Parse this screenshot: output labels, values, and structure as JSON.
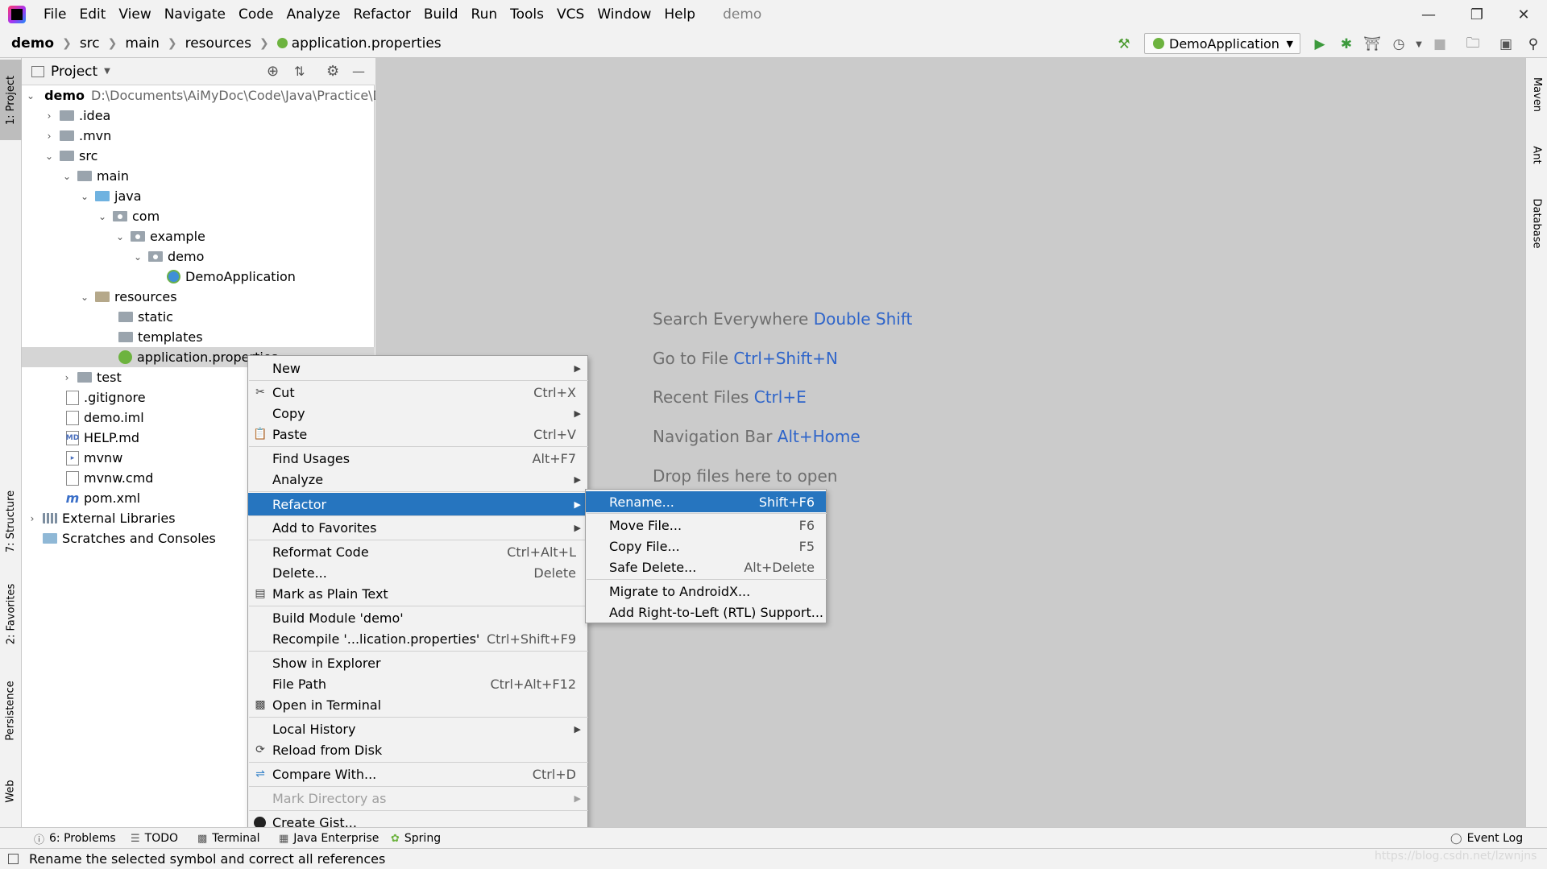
{
  "menubar": {
    "items": [
      "File",
      "Edit",
      "View",
      "Navigate",
      "Code",
      "Analyze",
      "Refactor",
      "Build",
      "Run",
      "Tools",
      "VCS",
      "Window",
      "Help"
    ],
    "window_title": "demo"
  },
  "breadcrumbs": [
    "demo",
    "src",
    "main",
    "resources",
    "application.properties"
  ],
  "run_config": "DemoApplication",
  "project_panel": {
    "title": "Project",
    "root_name": "demo",
    "root_path": "D:\\Documents\\AiMyDoc\\Code\\Java\\Practice\\D",
    "tree": [
      ".idea",
      ".mvn",
      "src",
      "main",
      "java",
      "com",
      "example",
      "demo",
      "DemoApplication",
      "resources",
      "static",
      "templates",
      "application.properties",
      "test",
      ".gitignore",
      "demo.iml",
      "HELP.md",
      "mvnw",
      "mvnw.cmd",
      "pom.xml",
      "External Libraries",
      "Scratches and Consoles"
    ]
  },
  "editor_hints": [
    {
      "label": "Search Everywhere",
      "key": "Double Shift"
    },
    {
      "label": "Go to File",
      "key": "Ctrl+Shift+N"
    },
    {
      "label": "Recent Files",
      "key": "Ctrl+E"
    },
    {
      "label": "Navigation Bar",
      "key": "Alt+Home"
    },
    {
      "label": "Drop files here to open",
      "key": ""
    }
  ],
  "context_menu": [
    {
      "label": "New",
      "shortcut": ""
    },
    {
      "label": "Cut",
      "shortcut": "Ctrl+X"
    },
    {
      "label": "Copy",
      "shortcut": ""
    },
    {
      "label": "Paste",
      "shortcut": "Ctrl+V"
    },
    {
      "label": "Find Usages",
      "shortcut": "Alt+F7"
    },
    {
      "label": "Analyze",
      "shortcut": ""
    },
    {
      "label": "Refactor",
      "shortcut": ""
    },
    {
      "label": "Add to Favorites",
      "shortcut": ""
    },
    {
      "label": "Reformat Code",
      "shortcut": "Ctrl+Alt+L"
    },
    {
      "label": "Delete...",
      "shortcut": "Delete"
    },
    {
      "label": "Mark as Plain Text",
      "shortcut": ""
    },
    {
      "label": "Build Module 'demo'",
      "shortcut": ""
    },
    {
      "label": "Recompile '...lication.properties'",
      "shortcut": "Ctrl+Shift+F9"
    },
    {
      "label": "Show in Explorer",
      "shortcut": ""
    },
    {
      "label": "File Path",
      "shortcut": "Ctrl+Alt+F12"
    },
    {
      "label": "Open in Terminal",
      "shortcut": ""
    },
    {
      "label": "Local History",
      "shortcut": ""
    },
    {
      "label": "Reload from Disk",
      "shortcut": ""
    },
    {
      "label": "Compare With...",
      "shortcut": "Ctrl+D"
    },
    {
      "label": "Mark Directory as",
      "shortcut": ""
    },
    {
      "label": "Create Gist...",
      "shortcut": ""
    }
  ],
  "refactor_submenu": [
    {
      "label": "Rename...",
      "shortcut": "Shift+F6"
    },
    {
      "label": "Move File...",
      "shortcut": "F6"
    },
    {
      "label": "Copy File...",
      "shortcut": "F5"
    },
    {
      "label": "Safe Delete...",
      "shortcut": "Alt+Delete"
    },
    {
      "label": "Migrate to AndroidX...",
      "shortcut": ""
    },
    {
      "label": "Add Right-to-Left (RTL) Support...",
      "shortcut": ""
    }
  ],
  "left_tabs": [
    "1: Project",
    "7: Structure",
    "2: Favorites",
    "Persistence",
    "Web"
  ],
  "right_tabs": [
    "Maven",
    "Ant",
    "Database"
  ],
  "bottom_tabs": [
    "6: Problems",
    "TODO",
    "Terminal",
    "Java Enterprise",
    "Spring"
  ],
  "event_log": "Event Log",
  "status_text": "Rename the selected symbol and correct all references",
  "watermark": "https://blog.csdn.net/lzwnjns",
  "colors": {
    "selection": "#2675bf",
    "editor_bg": "#cbcbcb",
    "hint_key": "#2f65ca"
  }
}
